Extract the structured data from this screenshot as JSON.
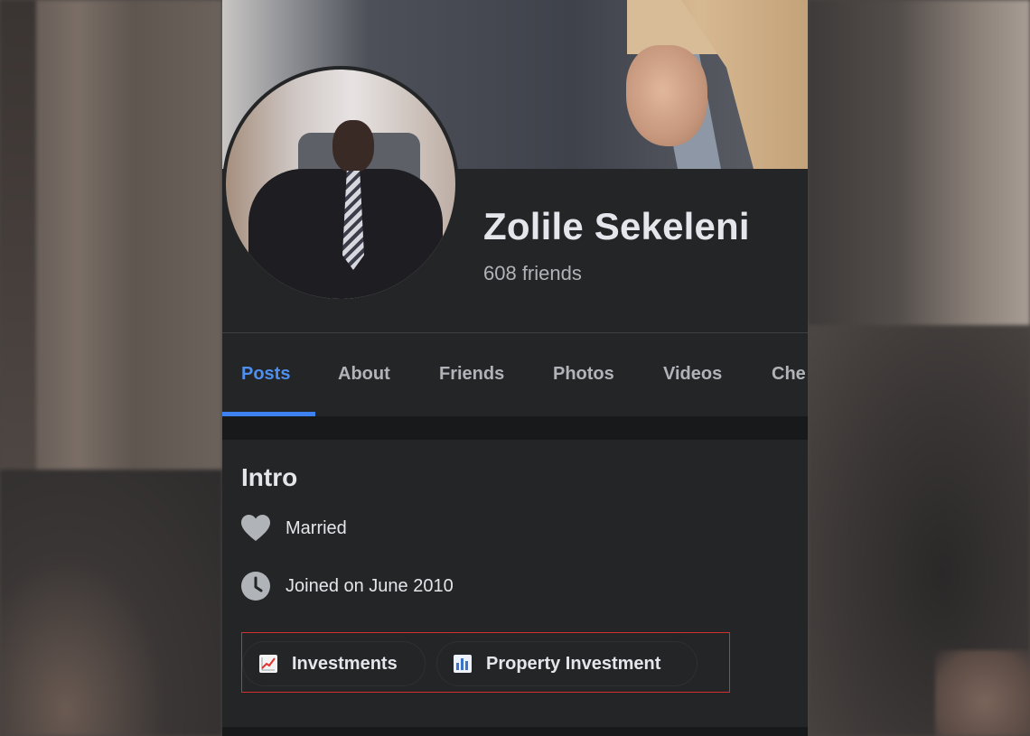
{
  "profile": {
    "name": "Zolile Sekeleni",
    "friends": "608 friends"
  },
  "tabs": [
    {
      "label": "Posts",
      "active": true
    },
    {
      "label": "About",
      "active": false
    },
    {
      "label": "Friends",
      "active": false
    },
    {
      "label": "Photos",
      "active": false
    },
    {
      "label": "Videos",
      "active": false
    },
    {
      "label": "Che",
      "active": false
    }
  ],
  "intro": {
    "title": "Intro",
    "relationship": {
      "icon": "heart-icon",
      "text": "Married"
    },
    "joined": {
      "icon": "clock-icon",
      "text": "Joined on June 2010"
    },
    "hobbies": [
      {
        "icon": "chart-increasing-icon",
        "label": "Investments"
      },
      {
        "icon": "bar-chart-icon",
        "label": "Property Investment"
      }
    ]
  },
  "colors": {
    "accent": "#3d82f0",
    "highlight_box": "#d0302f",
    "card_bg": "#242526"
  }
}
